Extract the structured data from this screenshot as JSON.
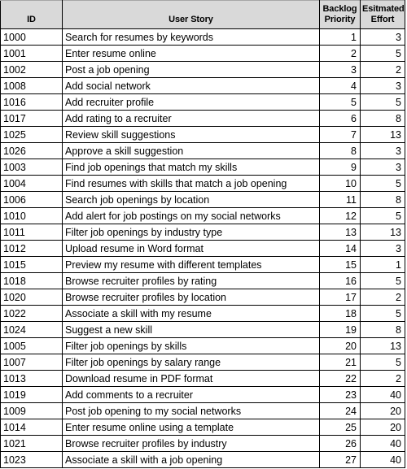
{
  "table": {
    "columns": [
      {
        "key": "id",
        "label": "ID",
        "align": "left"
      },
      {
        "key": "story",
        "label": "User Story",
        "align": "left"
      },
      {
        "key": "priority",
        "label": "Backlog Priority",
        "label_line1": "Backlog",
        "label_line2": "Priority",
        "align": "right"
      },
      {
        "key": "effort",
        "label": "Esitmated Effort",
        "label_line1": "Esitmated",
        "label_line2": "Effort",
        "align": "right"
      }
    ],
    "header_background": "#D9D9D9",
    "border_color": "#000000",
    "rows": [
      {
        "id": "1000",
        "story": "Search for resumes by keywords",
        "priority": "1",
        "effort": "3"
      },
      {
        "id": "1001",
        "story": "Enter resume online",
        "priority": "2",
        "effort": "5"
      },
      {
        "id": "1002",
        "story": "Post a job opening",
        "priority": "3",
        "effort": "2"
      },
      {
        "id": "1008",
        "story": "Add social network",
        "priority": "4",
        "effort": "3"
      },
      {
        "id": "1016",
        "story": "Add recruiter profile",
        "priority": "5",
        "effort": "5"
      },
      {
        "id": "1017",
        "story": "Add rating to a recruiter",
        "priority": "6",
        "effort": "8"
      },
      {
        "id": "1025",
        "story": "Review skill suggestions",
        "priority": "7",
        "effort": "13"
      },
      {
        "id": "1026",
        "story": "Approve a skill suggestion",
        "priority": "8",
        "effort": "3"
      },
      {
        "id": "1003",
        "story": "Find job openings that match my skills",
        "priority": "9",
        "effort": "3"
      },
      {
        "id": "1004",
        "story": "Find resumes with skills that match a job opening",
        "priority": "10",
        "effort": "5"
      },
      {
        "id": "1006",
        "story": "Search job openings by location",
        "priority": "11",
        "effort": "8"
      },
      {
        "id": "1010",
        "story": "Add alert for job postings on my social networks",
        "priority": "12",
        "effort": "5"
      },
      {
        "id": "1011",
        "story": "Filter job openings by industry type",
        "priority": "13",
        "effort": "13"
      },
      {
        "id": "1012",
        "story": "Upload resume in Word format",
        "priority": "14",
        "effort": "3"
      },
      {
        "id": "1015",
        "story": "Preview my resume with different templates",
        "priority": "15",
        "effort": "1"
      },
      {
        "id": "1018",
        "story": "Browse recruiter profiles by rating",
        "priority": "16",
        "effort": "5"
      },
      {
        "id": "1020",
        "story": "Browse recruiter profiles by location",
        "priority": "17",
        "effort": "2"
      },
      {
        "id": "1022",
        "story": "Associate a skill with my resume",
        "priority": "18",
        "effort": "5"
      },
      {
        "id": "1024",
        "story": "Suggest a new skill",
        "priority": "19",
        "effort": "8"
      },
      {
        "id": "1005",
        "story": "Filter job openings by skills",
        "priority": "20",
        "effort": "13"
      },
      {
        "id": "1007",
        "story": "Filter job openings by salary range",
        "priority": "21",
        "effort": "5"
      },
      {
        "id": "1013",
        "story": "Download resume in PDF format",
        "priority": "22",
        "effort": "2"
      },
      {
        "id": "1019",
        "story": "Add comments to a recruiter",
        "priority": "23",
        "effort": "40"
      },
      {
        "id": "1009",
        "story": "Post job opening to my social networks",
        "priority": "24",
        "effort": "20"
      },
      {
        "id": "1014",
        "story": "Enter resume online using a template",
        "priority": "25",
        "effort": "20"
      },
      {
        "id": "1021",
        "story": "Browse recruiter profiles by industry",
        "priority": "26",
        "effort": "40"
      },
      {
        "id": "1023",
        "story": "Associate a skill with a job opening",
        "priority": "27",
        "effort": "40"
      }
    ]
  }
}
